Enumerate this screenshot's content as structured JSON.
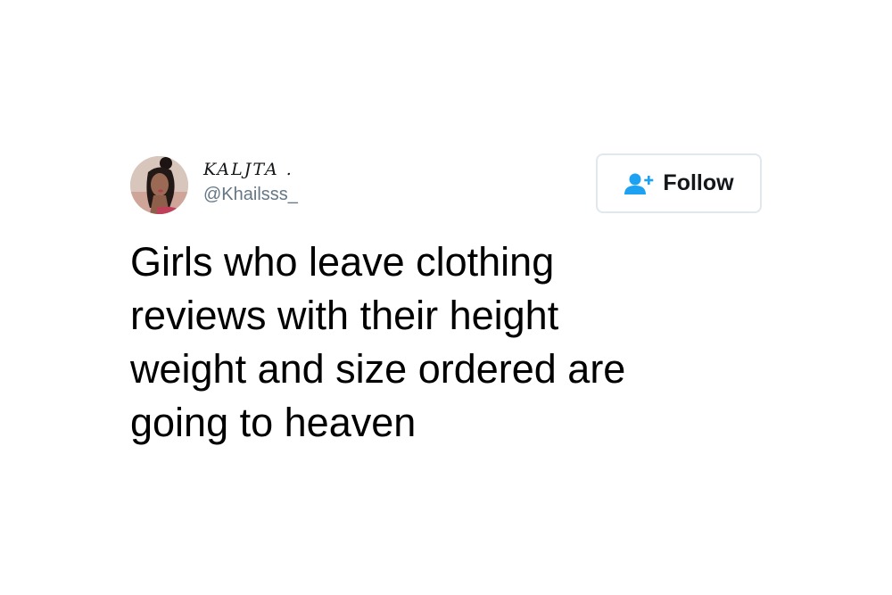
{
  "tweet": {
    "author": {
      "display_name": "KALJTA .",
      "handle": "@Khailsss_"
    },
    "follow_button": {
      "label": "Follow",
      "icon": "add-user-icon",
      "accent_color": "#1da1f2"
    },
    "text": "Girls who leave clothing\nreviews with their height\nweight and size ordered are\ngoing to heaven"
  }
}
